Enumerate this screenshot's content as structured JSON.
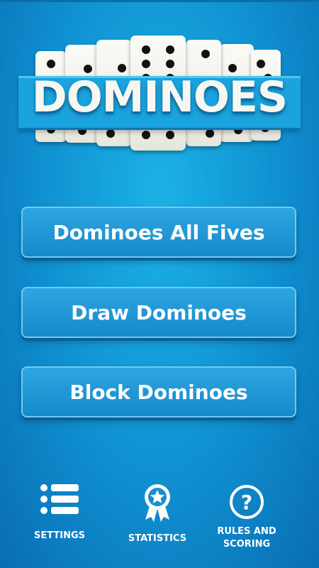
{
  "logo": {
    "title": "DOMINOES"
  },
  "menu": {
    "modes": [
      {
        "label": "Dominoes All Fives"
      },
      {
        "label": "Draw Dominoes"
      },
      {
        "label": "Block Dominoes"
      }
    ]
  },
  "bottom_nav": {
    "settings": {
      "label": "SETTINGS",
      "icon": "list-icon"
    },
    "statistics": {
      "label": "STATISTICS",
      "icon": "award-ribbon-icon"
    },
    "rules": {
      "label": "RULES AND SCORING",
      "icon": "question-circle-icon"
    }
  },
  "colors": {
    "background": "#1497d8",
    "button": "#1e93d3",
    "tile": "#f4f4ee",
    "pip": "#121212"
  }
}
